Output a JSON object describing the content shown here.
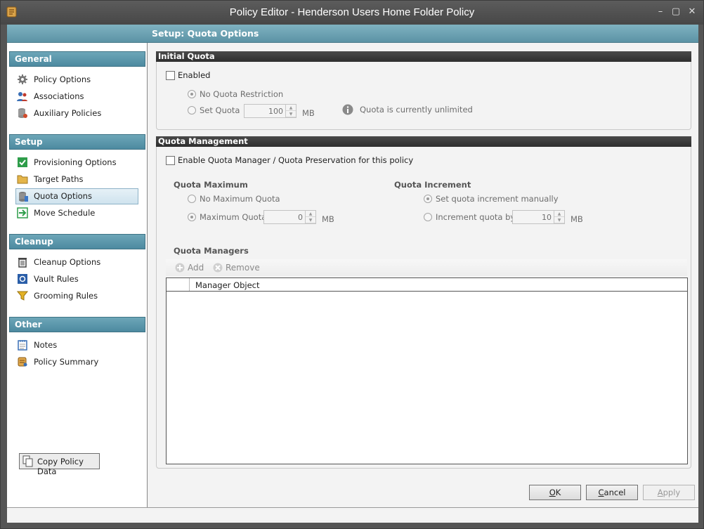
{
  "window": {
    "title": "Policy Editor - Henderson Users Home Folder Policy",
    "header": "Setup: Quota Options"
  },
  "sidebar": {
    "sections": [
      {
        "title": "General",
        "items": [
          "Policy Options",
          "Associations",
          "Auxiliary Policies"
        ]
      },
      {
        "title": "Setup",
        "items": [
          "Provisioning Options",
          "Target Paths",
          "Quota Options",
          "Move Schedule"
        ]
      },
      {
        "title": "Cleanup",
        "items": [
          "Cleanup Options",
          "Vault Rules",
          "Grooming Rules"
        ]
      },
      {
        "title": "Other",
        "items": [
          "Notes",
          "Policy Summary"
        ]
      }
    ],
    "selected_item": "Quota Options",
    "copy_button": "Copy Policy Data"
  },
  "initial_quota": {
    "title": "Initial Quota",
    "enabled_label": "Enabled",
    "enabled": false,
    "no_quota_label": "No Quota Restriction",
    "set_quota_label": "Set Quota",
    "set_quota_value": "100",
    "unit": "MB",
    "info_text": "Quota is currently unlimited"
  },
  "quota_management": {
    "title": "Quota Management",
    "enable_label": "Enable Quota Manager / Quota Preservation for this policy",
    "enabled": false,
    "maximum": {
      "title": "Quota Maximum",
      "no_max_label": "No Maximum Quota",
      "max_label": "Maximum Quota",
      "max_value": "0",
      "unit": "MB"
    },
    "increment": {
      "title": "Quota Increment",
      "manual_label": "Set quota increment manually",
      "increment_label": "Increment quota by",
      "increment_value": "10",
      "unit": "MB"
    },
    "managers": {
      "title": "Quota Managers",
      "add_label": "Add",
      "remove_label": "Remove",
      "column_header": "Manager Object"
    }
  },
  "buttons": {
    "ok": "OK",
    "cancel": "Cancel",
    "apply": "Apply"
  }
}
